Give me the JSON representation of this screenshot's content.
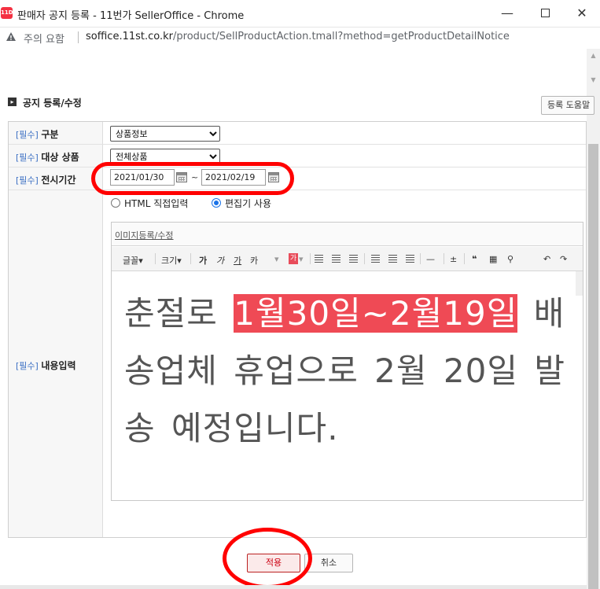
{
  "window": {
    "title": "판매자 공지 등록 - 11번가 SellerOffice - Chrome",
    "app_icon_text": "11D",
    "minimize": "—",
    "close": "✕"
  },
  "address_bar": {
    "warning": "주의 요함",
    "url_host": "soffice.11st.co.kr",
    "url_path": "/product/SellProductAction.tmall?method=getProductDetailNotice"
  },
  "section": {
    "title": "공지 등록/수정",
    "help_button": "등록 도움말"
  },
  "form": {
    "required_tag": "[필수]",
    "category": {
      "label": "구분",
      "value": "상품정보"
    },
    "target": {
      "label": "대상 상품",
      "value": "전체상품"
    },
    "period": {
      "label": "전시기간",
      "start": "2021/01/30",
      "separator": "~",
      "end": "2021/02/19"
    },
    "content": {
      "label": "내용입력",
      "radio_html": "HTML 직접입력",
      "radio_editor": "편집기 사용",
      "selected_mode": "editor"
    }
  },
  "editor": {
    "image_link": "이미지등록/수정",
    "toolbar": {
      "font": "글꼴",
      "size": "크기",
      "bold": "가",
      "italic": "가",
      "underline": "가",
      "strike": "카",
      "color": "가",
      "dropdown": "▾"
    },
    "text_before": "춘절로 ",
    "text_highlight": "1월30일~2월19일",
    "text_after": " 배송업체 휴업으로 2월 20일 발송 예정입니다.",
    "highlight_color": "#ef4a55"
  },
  "buttons": {
    "apply": "적용",
    "cancel": "취소"
  },
  "colors": {
    "annotation": "#ff0000",
    "required": "#3b6fc3"
  }
}
